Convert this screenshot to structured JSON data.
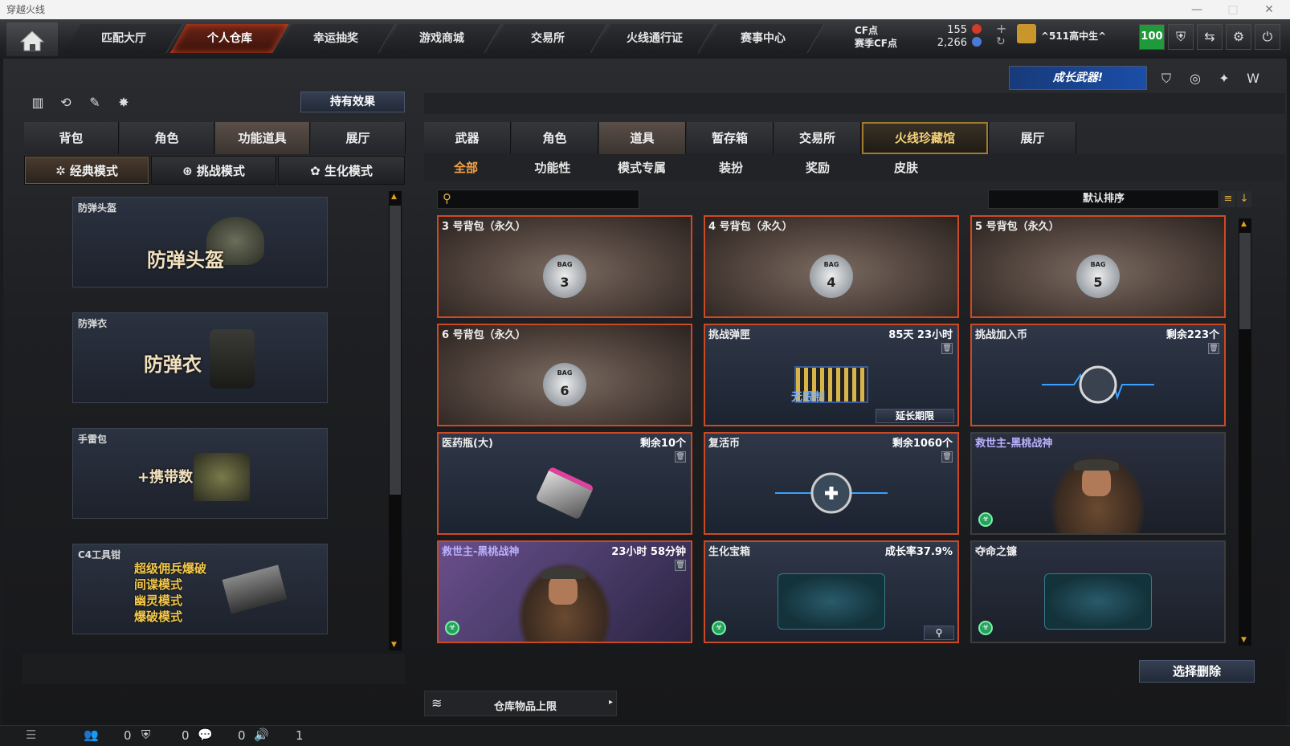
{
  "window": {
    "title": "穿越火线",
    "controls": [
      "—",
      "□",
      "✕"
    ]
  },
  "nav": {
    "tabs": [
      "匹配大厅",
      "个人仓库",
      "幸运抽奖",
      "游戏商城",
      "交易所",
      "火线通行证",
      "赛事中心"
    ],
    "active_index": 1,
    "cf_label": "CF点",
    "season_cf_label": "赛季CF点",
    "cf_value": "155",
    "season_cf_value": "2,266",
    "username": "^511高中生^",
    "level": "100"
  },
  "left": {
    "effects_button": "持有效果",
    "tabs": [
      "背包",
      "角色",
      "功能道具",
      "展厅"
    ],
    "active_tab": 2,
    "modes": [
      "经典模式",
      "挑战模式",
      "生化模式"
    ],
    "active_mode": 0,
    "items": [
      {
        "title": "防弹头盔",
        "big": "防弹头盔"
      },
      {
        "title": "防弹衣",
        "big": "防弹衣"
      },
      {
        "title": "手雷包",
        "big": "+携带数"
      },
      {
        "title": "C4工具钳",
        "lines": [
          "超级佣兵爆破",
          "间谍模式",
          "幽灵模式",
          "爆破模式"
        ]
      }
    ]
  },
  "right": {
    "banner": "成长武器!",
    "tabs": [
      "武器",
      "角色",
      "道具",
      "暂存箱",
      "交易所",
      "火线珍藏馆",
      "展厅"
    ],
    "active_tab": 2,
    "highlight_tab": 5,
    "subtabs": [
      "全部",
      "功能性",
      "模式专属",
      "装扮",
      "奖励",
      "皮肤"
    ],
    "active_subtab": 0,
    "search_placeholder": "",
    "sort_label": "默认排序",
    "items": [
      {
        "title": "3 号背包（永久）",
        "right": "",
        "badge": "3"
      },
      {
        "title": "4 号背包（永久）",
        "right": "",
        "badge": "4"
      },
      {
        "title": "5 号背包（永久）",
        "right": "",
        "badge": "5"
      },
      {
        "title": "6 号背包（永久）",
        "right": "",
        "badge": "6"
      },
      {
        "title": "挑战弹匣",
        "right": "85天 23小时",
        "extra": "延长期限",
        "logo": "无限制"
      },
      {
        "title": "挑战加入币",
        "right": "剩余223个"
      },
      {
        "title": "医药瓶(大)",
        "right": "剩余10个"
      },
      {
        "title": "复活币",
        "right": "剩余1060个"
      },
      {
        "title": "救世主-黑桃战神",
        "right": ""
      },
      {
        "title": "救世主-黑桃战神",
        "right": "23小时 58分钟"
      },
      {
        "title": "生化宝箱",
        "right": "成长率37.9%"
      },
      {
        "title": "夺命之镰",
        "right": ""
      }
    ],
    "delete_button": "选择删除",
    "storage_label": "仓库物品上限"
  },
  "status": {
    "v1": "0",
    "v2": "0",
    "v3": "0",
    "v4": "1"
  }
}
